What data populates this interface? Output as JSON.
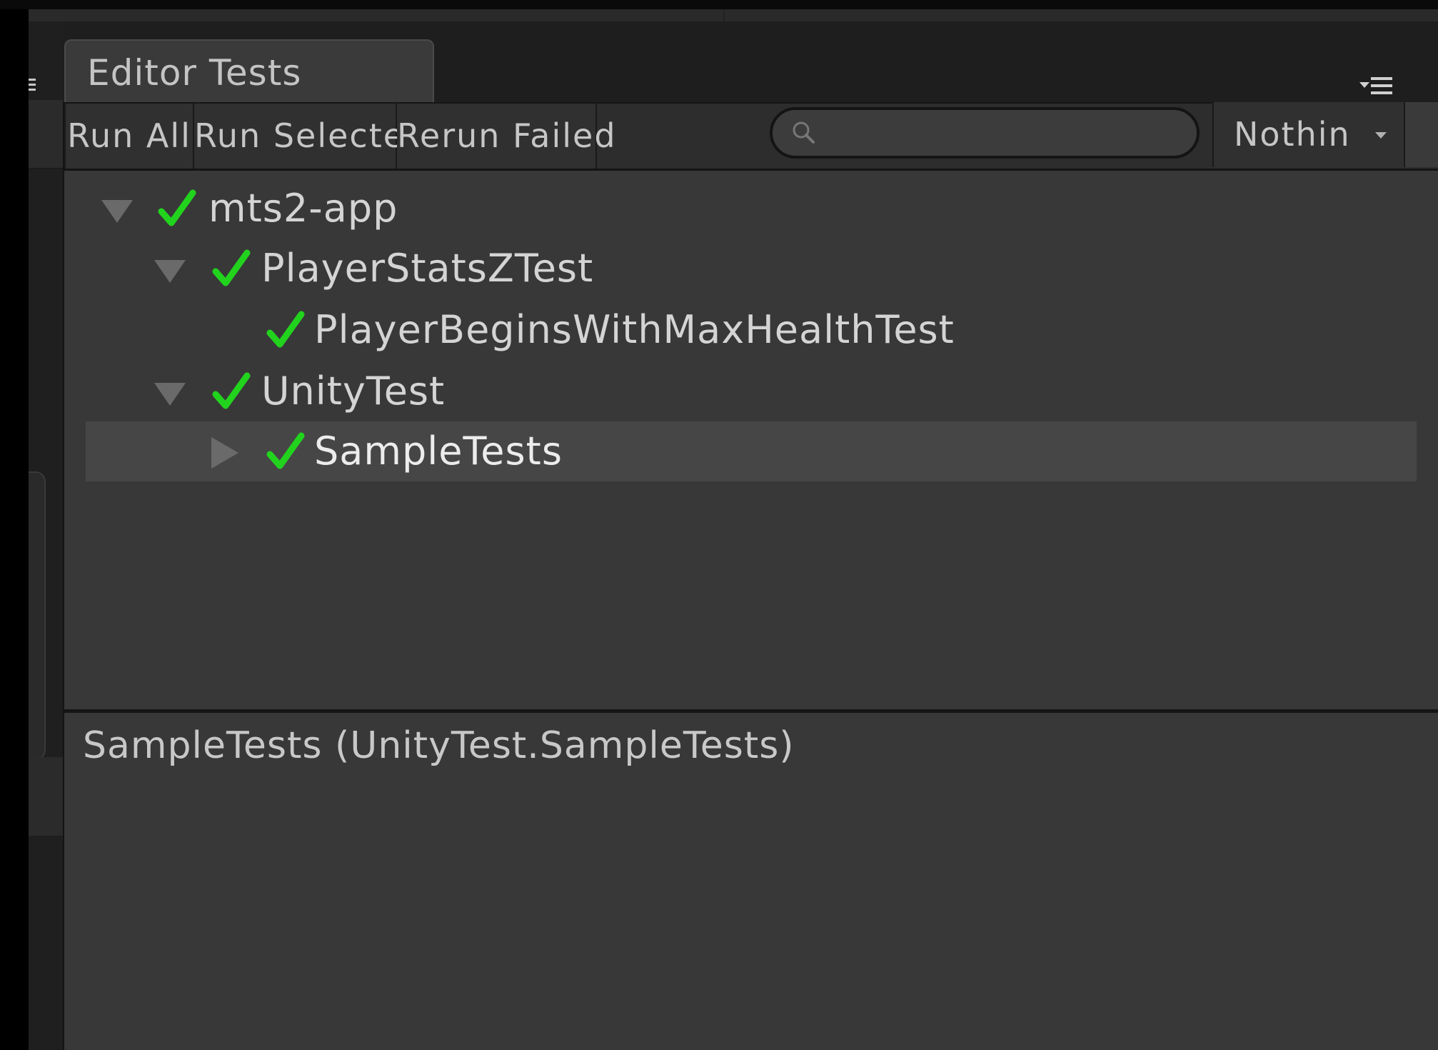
{
  "window": {
    "tab_title": "Editor Tests"
  },
  "toolbar": {
    "run_all_label": "Run All",
    "run_selected_label": "Run Selected",
    "rerun_failed_label": "Rerun Failed",
    "search_value": "",
    "search_placeholder": "",
    "filter_selected": "Nothin"
  },
  "tree": {
    "items": [
      {
        "label": "mts2-app",
        "status": "passed",
        "expanded": true,
        "depth": 0
      },
      {
        "label": "PlayerStatsZTest",
        "status": "passed",
        "expanded": true,
        "depth": 1
      },
      {
        "label": "PlayerBeginsWithMaxHealthTest",
        "status": "passed",
        "expanded": null,
        "depth": 2
      },
      {
        "label": "UnityTest",
        "status": "passed",
        "expanded": true,
        "depth": 1
      },
      {
        "label": "SampleTests",
        "status": "passed",
        "expanded": false,
        "depth": 2,
        "selected": true
      }
    ]
  },
  "details": {
    "text": "SampleTests (UnityTest.SampleTests)"
  },
  "colors": {
    "pass_check": "#22d31e",
    "panel_bg": "#383838",
    "selected_row": "#464646",
    "text": "#d4d4d4"
  }
}
